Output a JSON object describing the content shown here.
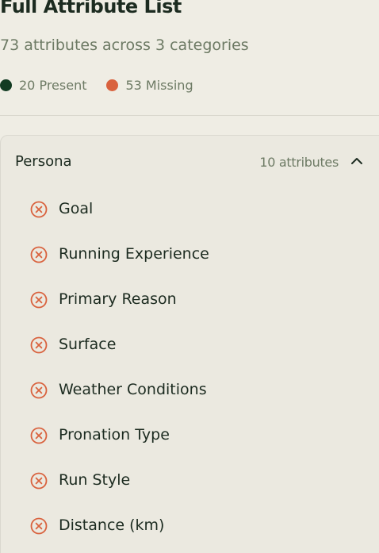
{
  "header": {
    "title": "Full Attribute List",
    "subtitle": "73 attributes across 3 categories"
  },
  "legend": {
    "present_label": "20 Present",
    "missing_label": "53 Missing",
    "present_color": "#123b22",
    "missing_color": "#d9623e"
  },
  "category": {
    "name": "Persona",
    "count_label": "10 attributes",
    "toggle_icon": "chevron-up-icon",
    "items": [
      {
        "label": "Goal",
        "status": "missing",
        "icon": "x-circle-icon"
      },
      {
        "label": "Running Experience",
        "status": "missing",
        "icon": "x-circle-icon"
      },
      {
        "label": "Primary Reason",
        "status": "missing",
        "icon": "x-circle-icon"
      },
      {
        "label": "Surface",
        "status": "missing",
        "icon": "x-circle-icon"
      },
      {
        "label": "Weather Conditions",
        "status": "missing",
        "icon": "x-circle-icon"
      },
      {
        "label": "Pronation Type",
        "status": "missing",
        "icon": "x-circle-icon"
      },
      {
        "label": "Run Style",
        "status": "missing",
        "icon": "x-circle-icon"
      },
      {
        "label": "Distance (km)",
        "status": "missing",
        "icon": "x-circle-icon"
      }
    ]
  }
}
